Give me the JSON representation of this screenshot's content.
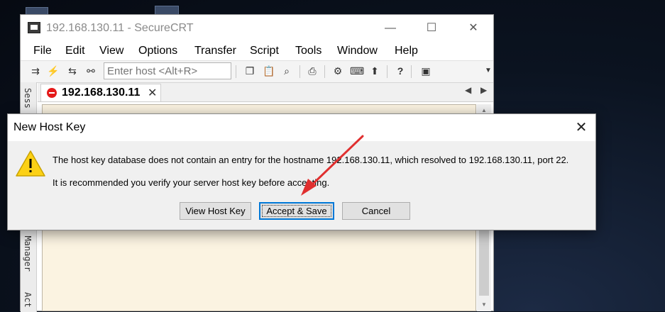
{
  "window": {
    "title": "192.168.130.11 - SecureCRT",
    "controls": {
      "minimize": "—",
      "maximize": "☐",
      "close": "✕"
    }
  },
  "menu": [
    "File",
    "Edit",
    "View",
    "Options",
    "Transfer",
    "Script",
    "Tools",
    "Window",
    "Help"
  ],
  "toolbar": {
    "host_placeholder": "Enter host <Alt+R>",
    "icons": [
      "connect-icon",
      "quick-connect-icon",
      "reconnect-icon",
      "disconnect-icon",
      "copy-icon",
      "paste-icon",
      "find-icon",
      "print-icon",
      "settings-icon",
      "keymap-icon",
      "sftp-icon",
      "help-icon",
      "screenshot-icon",
      "dropdown-icon"
    ]
  },
  "sidebar": {
    "session_label": "Sess",
    "manager_label": "l Manager",
    "activity_label": "Act"
  },
  "tabs": [
    {
      "label": "192.168.130.11",
      "status": "disconnected"
    }
  ],
  "dialog": {
    "title": "New Host Key",
    "message_line1": "The host key database does not contain an entry for the hostname 192.168.130.11, which resolved to 192.168.130.11, port 22.",
    "message_line2": "It is recommended you verify your server host key before accepting.",
    "buttons": {
      "view": "View Host Key",
      "accept": "Accept & Save",
      "cancel": "Cancel"
    }
  },
  "colors": {
    "terminal_bg": "#fbf3e1",
    "accent": "#0078d7",
    "annotation_arrow": "#e02f2f",
    "tab_status": "#e51a1a"
  }
}
